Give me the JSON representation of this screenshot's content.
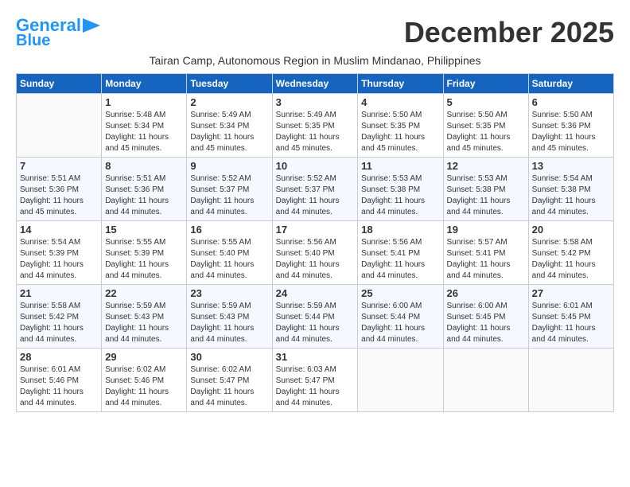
{
  "header": {
    "logo_line1": "General",
    "logo_line2": "Blue",
    "month_title": "December 2025",
    "subtitle": "Tairan Camp, Autonomous Region in Muslim Mindanao, Philippines"
  },
  "weekdays": [
    "Sunday",
    "Monday",
    "Tuesday",
    "Wednesday",
    "Thursday",
    "Friday",
    "Saturday"
  ],
  "weeks": [
    [
      {
        "day": "",
        "info": ""
      },
      {
        "day": "1",
        "info": "Sunrise: 5:48 AM\nSunset: 5:34 PM\nDaylight: 11 hours\nand 45 minutes."
      },
      {
        "day": "2",
        "info": "Sunrise: 5:49 AM\nSunset: 5:34 PM\nDaylight: 11 hours\nand 45 minutes."
      },
      {
        "day": "3",
        "info": "Sunrise: 5:49 AM\nSunset: 5:35 PM\nDaylight: 11 hours\nand 45 minutes."
      },
      {
        "day": "4",
        "info": "Sunrise: 5:50 AM\nSunset: 5:35 PM\nDaylight: 11 hours\nand 45 minutes."
      },
      {
        "day": "5",
        "info": "Sunrise: 5:50 AM\nSunset: 5:35 PM\nDaylight: 11 hours\nand 45 minutes."
      },
      {
        "day": "6",
        "info": "Sunrise: 5:50 AM\nSunset: 5:36 PM\nDaylight: 11 hours\nand 45 minutes."
      }
    ],
    [
      {
        "day": "7",
        "info": "Sunrise: 5:51 AM\nSunset: 5:36 PM\nDaylight: 11 hours\nand 45 minutes."
      },
      {
        "day": "8",
        "info": "Sunrise: 5:51 AM\nSunset: 5:36 PM\nDaylight: 11 hours\nand 44 minutes."
      },
      {
        "day": "9",
        "info": "Sunrise: 5:52 AM\nSunset: 5:37 PM\nDaylight: 11 hours\nand 44 minutes."
      },
      {
        "day": "10",
        "info": "Sunrise: 5:52 AM\nSunset: 5:37 PM\nDaylight: 11 hours\nand 44 minutes."
      },
      {
        "day": "11",
        "info": "Sunrise: 5:53 AM\nSunset: 5:38 PM\nDaylight: 11 hours\nand 44 minutes."
      },
      {
        "day": "12",
        "info": "Sunrise: 5:53 AM\nSunset: 5:38 PM\nDaylight: 11 hours\nand 44 minutes."
      },
      {
        "day": "13",
        "info": "Sunrise: 5:54 AM\nSunset: 5:38 PM\nDaylight: 11 hours\nand 44 minutes."
      }
    ],
    [
      {
        "day": "14",
        "info": "Sunrise: 5:54 AM\nSunset: 5:39 PM\nDaylight: 11 hours\nand 44 minutes."
      },
      {
        "day": "15",
        "info": "Sunrise: 5:55 AM\nSunset: 5:39 PM\nDaylight: 11 hours\nand 44 minutes."
      },
      {
        "day": "16",
        "info": "Sunrise: 5:55 AM\nSunset: 5:40 PM\nDaylight: 11 hours\nand 44 minutes."
      },
      {
        "day": "17",
        "info": "Sunrise: 5:56 AM\nSunset: 5:40 PM\nDaylight: 11 hours\nand 44 minutes."
      },
      {
        "day": "18",
        "info": "Sunrise: 5:56 AM\nSunset: 5:41 PM\nDaylight: 11 hours\nand 44 minutes."
      },
      {
        "day": "19",
        "info": "Sunrise: 5:57 AM\nSunset: 5:41 PM\nDaylight: 11 hours\nand 44 minutes."
      },
      {
        "day": "20",
        "info": "Sunrise: 5:58 AM\nSunset: 5:42 PM\nDaylight: 11 hours\nand 44 minutes."
      }
    ],
    [
      {
        "day": "21",
        "info": "Sunrise: 5:58 AM\nSunset: 5:42 PM\nDaylight: 11 hours\nand 44 minutes."
      },
      {
        "day": "22",
        "info": "Sunrise: 5:59 AM\nSunset: 5:43 PM\nDaylight: 11 hours\nand 44 minutes."
      },
      {
        "day": "23",
        "info": "Sunrise: 5:59 AM\nSunset: 5:43 PM\nDaylight: 11 hours\nand 44 minutes."
      },
      {
        "day": "24",
        "info": "Sunrise: 5:59 AM\nSunset: 5:44 PM\nDaylight: 11 hours\nand 44 minutes."
      },
      {
        "day": "25",
        "info": "Sunrise: 6:00 AM\nSunset: 5:44 PM\nDaylight: 11 hours\nand 44 minutes."
      },
      {
        "day": "26",
        "info": "Sunrise: 6:00 AM\nSunset: 5:45 PM\nDaylight: 11 hours\nand 44 minutes."
      },
      {
        "day": "27",
        "info": "Sunrise: 6:01 AM\nSunset: 5:45 PM\nDaylight: 11 hours\nand 44 minutes."
      }
    ],
    [
      {
        "day": "28",
        "info": "Sunrise: 6:01 AM\nSunset: 5:46 PM\nDaylight: 11 hours\nand 44 minutes."
      },
      {
        "day": "29",
        "info": "Sunrise: 6:02 AM\nSunset: 5:46 PM\nDaylight: 11 hours\nand 44 minutes."
      },
      {
        "day": "30",
        "info": "Sunrise: 6:02 AM\nSunset: 5:47 PM\nDaylight: 11 hours\nand 44 minutes."
      },
      {
        "day": "31",
        "info": "Sunrise: 6:03 AM\nSunset: 5:47 PM\nDaylight: 11 hours\nand 44 minutes."
      },
      {
        "day": "",
        "info": ""
      },
      {
        "day": "",
        "info": ""
      },
      {
        "day": "",
        "info": ""
      }
    ]
  ]
}
